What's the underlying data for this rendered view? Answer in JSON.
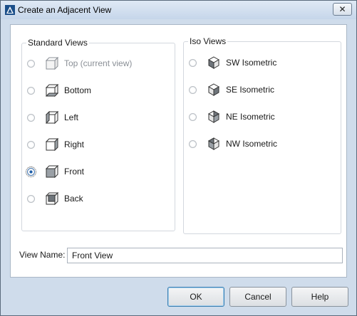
{
  "window": {
    "title": "Create an Adjacent View",
    "close_glyph": "✕"
  },
  "standard_views": {
    "title": "Standard Views",
    "items": [
      {
        "label": "Top (current view)",
        "enabled": false,
        "selected": false,
        "icon": "cube-top-icon"
      },
      {
        "label": "Bottom",
        "enabled": true,
        "selected": false,
        "icon": "cube-bottom-icon"
      },
      {
        "label": "Left",
        "enabled": true,
        "selected": false,
        "icon": "cube-left-icon"
      },
      {
        "label": "Right",
        "enabled": true,
        "selected": false,
        "icon": "cube-right-icon"
      },
      {
        "label": "Front",
        "enabled": true,
        "selected": true,
        "icon": "cube-front-icon"
      },
      {
        "label": "Back",
        "enabled": true,
        "selected": false,
        "icon": "cube-back-icon"
      }
    ]
  },
  "iso_views": {
    "title": "Iso Views",
    "items": [
      {
        "label": "SW Isometric",
        "enabled": true,
        "selected": false,
        "icon": "iso-sw-icon"
      },
      {
        "label": "SE Isometric",
        "enabled": true,
        "selected": false,
        "icon": "iso-se-icon"
      },
      {
        "label": "NE Isometric",
        "enabled": true,
        "selected": false,
        "icon": "iso-ne-icon"
      },
      {
        "label": "NW Isometric",
        "enabled": true,
        "selected": false,
        "icon": "iso-nw-icon"
      }
    ]
  },
  "view_name": {
    "label": "View Name:",
    "value": "Front View"
  },
  "buttons": {
    "ok": "OK",
    "cancel": "Cancel",
    "help": "Help"
  },
  "colors": {
    "frame": "#cfdceb",
    "selected_radio": "#1f5ea8",
    "default_button_border": "#3c7fb1"
  }
}
